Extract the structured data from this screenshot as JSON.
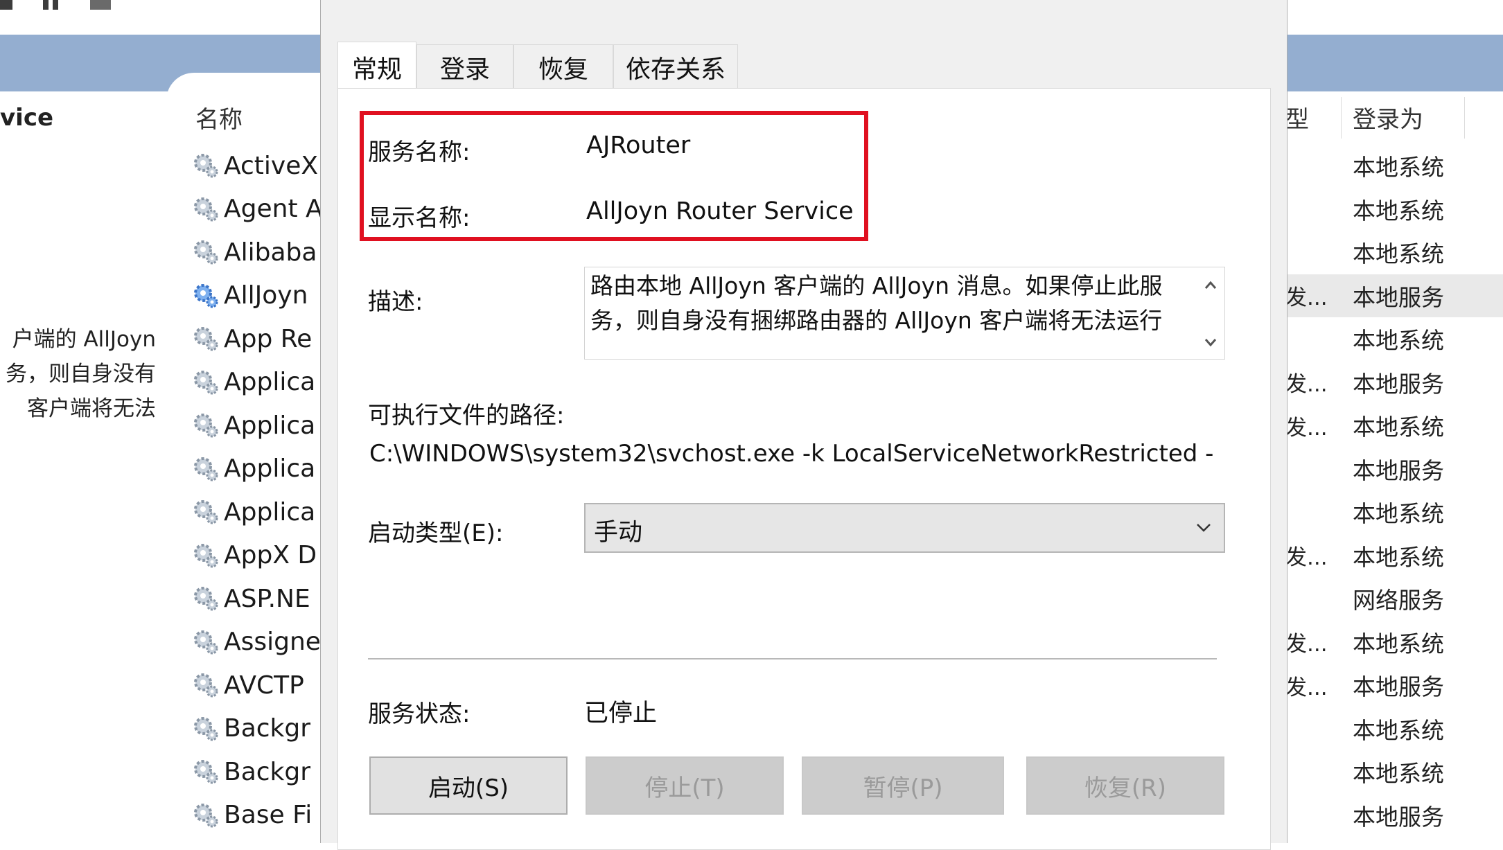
{
  "background": {
    "left_title_fragment": "vice",
    "left_description_lines": [
      "户端的 AllJoyn",
      "务，则自身没有",
      "客户端将无法"
    ],
    "name_column_header": "名称",
    "services": [
      {
        "name": "ActiveX"
      },
      {
        "name": "Agent A"
      },
      {
        "name": "Alibaba"
      },
      {
        "name": "AllJoyn"
      },
      {
        "name": "App Re"
      },
      {
        "name": "Applica"
      },
      {
        "name": "Applica"
      },
      {
        "name": "Applica"
      },
      {
        "name": "Applica"
      },
      {
        "name": "AppX D"
      },
      {
        "name": "ASP.NE"
      },
      {
        "name": "Assigne"
      },
      {
        "name": "AVCTP"
      },
      {
        "name": "Backgr"
      },
      {
        "name": "Backgr"
      },
      {
        "name": "Base Fi"
      }
    ],
    "right_columns": {
      "type_header_fragment": "型",
      "logon_header": "登录为",
      "rows": [
        {
          "frag": "",
          "logon": "本地系统"
        },
        {
          "frag": "",
          "logon": "本地系统"
        },
        {
          "frag": "",
          "logon": "本地系统"
        },
        {
          "frag": "发...",
          "logon": "本地服务"
        },
        {
          "frag": "",
          "logon": "本地系统"
        },
        {
          "frag": "发...",
          "logon": "本地服务"
        },
        {
          "frag": "发...",
          "logon": "本地系统"
        },
        {
          "frag": "",
          "logon": "本地服务"
        },
        {
          "frag": "",
          "logon": "本地系统"
        },
        {
          "frag": "发...",
          "logon": "本地系统"
        },
        {
          "frag": "",
          "logon": "网络服务"
        },
        {
          "frag": "发...",
          "logon": "本地系统"
        },
        {
          "frag": "发...",
          "logon": "本地服务"
        },
        {
          "frag": "",
          "logon": "本地系统"
        },
        {
          "frag": "",
          "logon": "本地系统"
        },
        {
          "frag": "",
          "logon": "本地服务"
        }
      ]
    }
  },
  "dialog": {
    "tabs": [
      {
        "label": "常规",
        "active": true
      },
      {
        "label": "登录",
        "active": false
      },
      {
        "label": "恢复",
        "active": false
      },
      {
        "label": "依存关系",
        "active": false
      }
    ],
    "service_name_label": "服务名称:",
    "service_name_value": "AJRouter",
    "display_name_label": "显示名称:",
    "display_name_value": "AllJoyn Router Service",
    "description_label": "描述:",
    "description_text": "路由本地 AllJoyn 客户端的 AllJoyn 消息。如果停止此服务，则自身没有捆绑路由器的 AllJoyn 客户端将无法运行",
    "exe_path_label": "可执行文件的路径:",
    "exe_path_value": "C:\\WINDOWS\\system32\\svchost.exe -k LocalServiceNetworkRestricted -",
    "startup_type_label": "启动类型(E):",
    "startup_type_value": "手动",
    "service_status_label": "服务状态:",
    "service_status_value": "已停止",
    "buttons": {
      "start": "启动(S)",
      "stop": "停止(T)",
      "pause": "暂停(P)",
      "resume": "恢复(R)"
    },
    "highlight_color": "#e01020"
  }
}
